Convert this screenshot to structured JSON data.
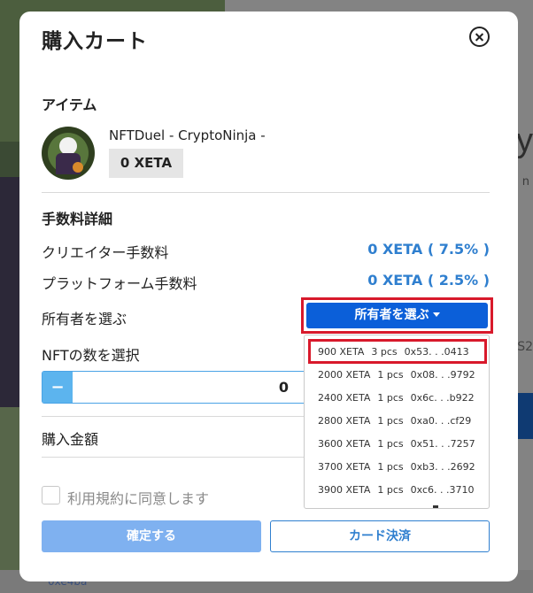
{
  "background": {
    "big_text": "y",
    "small_text": "n",
    "price_text": "S2",
    "footer_link": "0xe4ba"
  },
  "modal": {
    "title": "購入カート",
    "close_icon": "close-circle-icon",
    "item_section": {
      "heading": "アイテム",
      "name": "NFTDuel - CryptoNinja -",
      "price": "0  XETA"
    },
    "fee_section": {
      "heading": "手数料詳細",
      "creator_label": "クリエイター手数料",
      "creator_value": "0 XETA ( 7.5% )",
      "platform_label": "プラットフォーム手数料",
      "platform_value": "0 XETA ( 2.5% )"
    },
    "owner": {
      "label": "所有者を選ぶ",
      "button_label": "所有者を選ぶ"
    },
    "count": {
      "label": "NFTの数を選択",
      "minus": "−",
      "value": "0"
    },
    "total": {
      "label": "購入金額"
    },
    "terms": {
      "label": "利用規約に同意します"
    },
    "buttons": {
      "confirm": "確定する",
      "card": "カード決済"
    },
    "colors": {
      "accent": "#2f7fcf",
      "primary_button": "#0b5fd9",
      "highlight": "#d8192b"
    }
  },
  "owner_dropdown": {
    "items": [
      {
        "price": "900 XETA",
        "qty": "3 pcs",
        "address": "0x53. . .0413"
      },
      {
        "price": "2000 XETA",
        "qty": "1 pcs",
        "address": "0x08. . .9792"
      },
      {
        "price": "2400 XETA",
        "qty": "1 pcs",
        "address": "0x6c. . .b922"
      },
      {
        "price": "2800 XETA",
        "qty": "1 pcs",
        "address": "0xa0. . .cf29"
      },
      {
        "price": "3600 XETA",
        "qty": "1 pcs",
        "address": "0x51. . .7257"
      },
      {
        "price": "3700 XETA",
        "qty": "1 pcs",
        "address": "0xb3. . .2692"
      },
      {
        "price": "3900 XETA",
        "qty": "1 pcs",
        "address": "0xc6. . .3710"
      }
    ]
  }
}
